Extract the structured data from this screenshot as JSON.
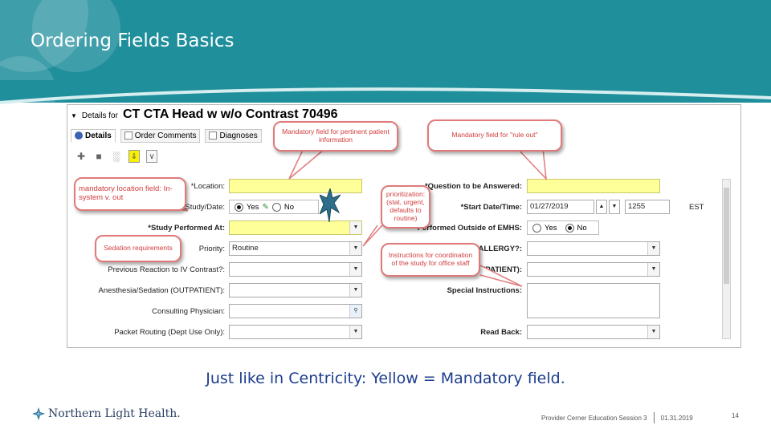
{
  "slide": {
    "title": "Ordering Fields Basics",
    "caption": "Just like in Centricity: Yellow = Mandatory field.",
    "footer": {
      "brand": "Northern Light Health.",
      "session": "Provider Cerner Education Session 3",
      "date": "01.31.2019",
      "page": "14"
    }
  },
  "screenshot": {
    "details_prefix": "Details for",
    "order_name": "CT CTA Head w  w/o Contrast 70496",
    "tabs": [
      {
        "label": "Details"
      },
      {
        "label": "Order Comments"
      },
      {
        "label": "Diagnoses"
      }
    ],
    "fields_left": [
      {
        "label": "*Location:",
        "value": "",
        "mandatory": true
      },
      {
        "label": "Study/Date:",
        "value": ""
      },
      {
        "label": "*Study Performed At:",
        "value": "",
        "mandatory": true
      },
      {
        "label": "Priority:",
        "value": "Routine"
      },
      {
        "label": "Previous Reaction to IV Contrast?:",
        "value": ""
      },
      {
        "label": "Anesthesia/Sedation (OUTPATIENT):",
        "value": ""
      },
      {
        "label": "Consulting Physician:",
        "value": ""
      },
      {
        "label": "Packet Routing (Dept Use Only):",
        "value": ""
      }
    ],
    "study_date_options": [
      "Yes",
      "No"
    ],
    "fields_right": [
      {
        "label": "*Question to be Answered:",
        "value": "",
        "mandatory": true
      },
      {
        "label": "*Start Date/Time:",
        "date": "01/27/2019",
        "time": "1255",
        "tz": "EST"
      },
      {
        "label": "Performed Outside of EMHS:",
        "options": [
          "Yes",
          "No"
        ],
        "selected": "No"
      },
      {
        "label": "X ALLERGY?:",
        "value": ""
      },
      {
        "label": "(OUTPATIENT):",
        "value": ""
      },
      {
        "label": "Special Instructions:",
        "value": ""
      },
      {
        "label": "Read Back:",
        "value": ""
      }
    ]
  },
  "callouts": {
    "mandatory_pertinent": "Mandatory field for pertinent patient information",
    "mandatory_rule_out": "Mandatory field for \"rule out\"",
    "location": "mandatory location field: In-system v. out",
    "prioritization": "prioritization: (stat, urgent, defaults to routine)",
    "sedation": "Sedation requirements",
    "coordination": "Instructions for coordination of the study for office staff"
  },
  "colors": {
    "header": "#1f8f9c",
    "mandatory_fill": "#ffff9a",
    "callout_border": "#e07a7a",
    "callout_text": "#d23c3c",
    "caption": "#1d3d8f"
  }
}
